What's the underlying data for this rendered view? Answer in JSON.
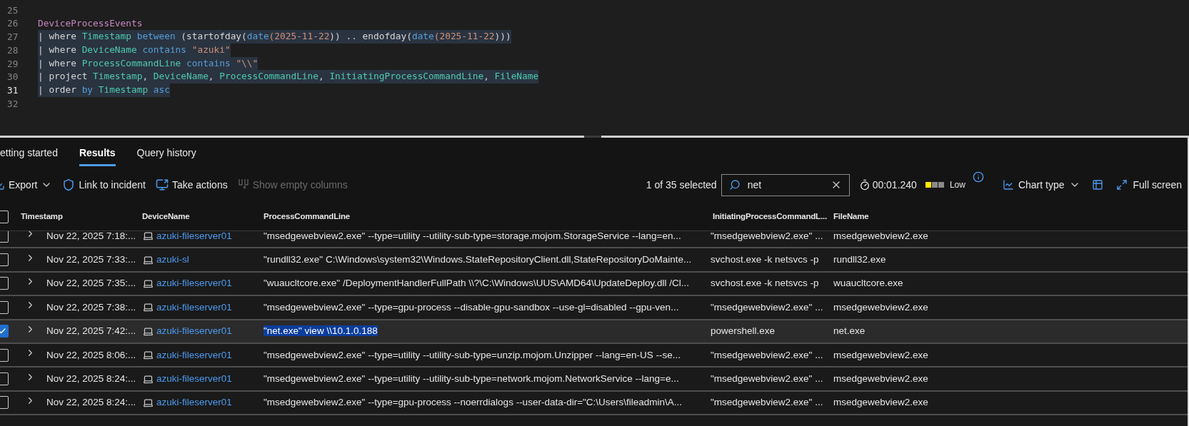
{
  "editor": {
    "lines": [
      {
        "number": "25",
        "current": false,
        "highlighted": false
      },
      {
        "number": "26",
        "current": false,
        "highlighted": false,
        "tokens": [
          {
            "text": "DeviceProcessEvents",
            "kind": "table"
          }
        ]
      },
      {
        "number": "27",
        "current": false,
        "highlighted": true,
        "tokens": [
          {
            "text": "| where ",
            "kind": "plain"
          },
          {
            "text": "Timestamp",
            "kind": "column"
          },
          {
            "text": " between ",
            "kind": "operator"
          },
          {
            "text": "(startofday(",
            "kind": "plain"
          },
          {
            "text": "date",
            "kind": "operator"
          },
          {
            "text": "(2025-11-22",
            "kind": "literal"
          },
          {
            "text": ")) .. endofday(",
            "kind": "plain"
          },
          {
            "text": "date",
            "kind": "operator"
          },
          {
            "text": "(2025-11-22",
            "kind": "literal"
          },
          {
            "text": ")))",
            "kind": "plain"
          }
        ]
      },
      {
        "number": "28",
        "current": false,
        "highlighted": true,
        "tokens": [
          {
            "text": "| where ",
            "kind": "plain"
          },
          {
            "text": "DeviceName",
            "kind": "column"
          },
          {
            "text": " contains ",
            "kind": "operator"
          },
          {
            "text": "\"azuki\"",
            "kind": "literal"
          }
        ]
      },
      {
        "number": "29",
        "current": false,
        "highlighted": true,
        "tokens": [
          {
            "text": "| where ",
            "kind": "plain"
          },
          {
            "text": "ProcessCommandLine",
            "kind": "column"
          },
          {
            "text": " contains ",
            "kind": "operator"
          },
          {
            "text": "\"\\\\\"",
            "kind": "literal"
          }
        ]
      },
      {
        "number": "30",
        "current": false,
        "highlighted": true,
        "tokens": [
          {
            "text": "| project ",
            "kind": "plain"
          },
          {
            "text": "Timestamp",
            "kind": "column"
          },
          {
            "text": ", ",
            "kind": "plain"
          },
          {
            "text": "DeviceName",
            "kind": "column"
          },
          {
            "text": ", ",
            "kind": "plain"
          },
          {
            "text": "ProcessCommandLine",
            "kind": "column"
          },
          {
            "text": ", ",
            "kind": "plain"
          },
          {
            "text": "InitiatingProcessCommandLine",
            "kind": "column"
          },
          {
            "text": ", ",
            "kind": "plain"
          },
          {
            "text": "FileName",
            "kind": "column"
          }
        ]
      },
      {
        "number": "31",
        "current": true,
        "highlighted": true,
        "tokens": [
          {
            "text": "| order ",
            "kind": "plain"
          },
          {
            "text": "by ",
            "kind": "operator"
          },
          {
            "text": "Timestamp",
            "kind": "column"
          },
          {
            "text": " asc",
            "kind": "operator"
          }
        ]
      },
      {
        "number": "32",
        "current": false,
        "highlighted": false
      }
    ]
  },
  "tabs": [
    {
      "label": "etting started",
      "selected": false
    },
    {
      "label": "Results",
      "selected": true
    },
    {
      "label": "Query history",
      "selected": false
    }
  ],
  "toolbar": {
    "actions": [
      {
        "label": "Export",
        "kind": "menu",
        "disabled": false
      },
      {
        "label": "Link to incident",
        "kind": "link",
        "disabled": false
      },
      {
        "label": "Take actions",
        "kind": "actions",
        "disabled": false
      },
      {
        "label": "Show empty columns",
        "kind": "columns",
        "disabled": true
      }
    ],
    "selection_count": "1 of 35 selected",
    "search": {
      "value": "net"
    },
    "duration": "00:01.240",
    "resource_usage": {
      "label": "Low",
      "level": 0.33
    },
    "chart_type": "Chart type",
    "full_screen": "Full screen"
  },
  "table": {
    "select_all_checked": false,
    "columns": [
      "Timestamp",
      "DeviceName",
      "ProcessCommandLine",
      "InitiatingProcessCommandL...",
      "FileName"
    ],
    "rows": [
      {
        "selected": false,
        "command_highlighted": false,
        "timestamp": "Nov 22, 2025 7:18:...",
        "device": "azuki-fileserver01",
        "command": "\"msedgewebview2.exe\" --type=utility --utility-sub-type=storage.mojom.StorageService --lang=en...",
        "initiating": "\"msedgewebview2.exe\" ...",
        "file": "msedgewebview2.exe"
      },
      {
        "selected": false,
        "command_highlighted": false,
        "timestamp": "Nov 22, 2025 7:33:...",
        "device": "azuki-sl",
        "command": "\"rundll32.exe\" C:\\Windows\\system32\\Windows.StateRepositoryClient.dll,StateRepositoryDoMainte...",
        "initiating": "svchost.exe -k netsvcs -p",
        "file": "rundll32.exe"
      },
      {
        "selected": false,
        "command_highlighted": false,
        "timestamp": "Nov 22, 2025 7:35:...",
        "device": "azuki-fileserver01",
        "command": "\"wuaucltcore.exe\" /DeploymentHandlerFullPath \\\\?\\C:\\Windows\\UUS\\AMD64\\UpdateDeploy.dll /Cl...",
        "initiating": "svchost.exe -k netsvcs -p",
        "file": "wuaucltcore.exe"
      },
      {
        "selected": false,
        "command_highlighted": false,
        "timestamp": "Nov 22, 2025 7:38:...",
        "device": "azuki-fileserver01",
        "command": "\"msedgewebview2.exe\" --type=gpu-process --disable-gpu-sandbox --use-gl=disabled --gpu-ven...",
        "initiating": "\"msedgewebview2.exe\" ...",
        "file": "msedgewebview2.exe"
      },
      {
        "selected": true,
        "command_highlighted": true,
        "timestamp": "Nov 22, 2025 7:42:...",
        "device": "azuki-fileserver01",
        "command": "\"net.exe\" view \\\\10.1.0.188",
        "initiating": "powershell.exe",
        "file": "net.exe"
      },
      {
        "selected": false,
        "command_highlighted": false,
        "timestamp": "Nov 22, 2025 8:06:...",
        "device": "azuki-fileserver01",
        "command": "\"msedgewebview2.exe\" --type=utility --utility-sub-type=unzip.mojom.Unzipper --lang=en-US --se...",
        "initiating": "\"msedgewebview2.exe\" ...",
        "file": "msedgewebview2.exe"
      },
      {
        "selected": false,
        "command_highlighted": false,
        "timestamp": "Nov 22, 2025 8:24:...",
        "device": "azuki-fileserver01",
        "command": "\"msedgewebview2.exe\" --type=utility --utility-sub-type=network.mojom.NetworkService --lang=e...",
        "initiating": "\"msedgewebview2.exe\" ...",
        "file": "msedgewebview2.exe"
      },
      {
        "selected": false,
        "command_highlighted": false,
        "timestamp": "Nov 22, 2025 8:24:...",
        "device": "azuki-fileserver01",
        "command": "\"msedgewebview2.exe\" --type=gpu-process --noerrdialogs --user-data-dir=\"C:\\Users\\fileadmin\\A...",
        "initiating": "\"msedgewebview2.exe\" ...",
        "file": "msedgewebview2.exe"
      }
    ]
  }
}
